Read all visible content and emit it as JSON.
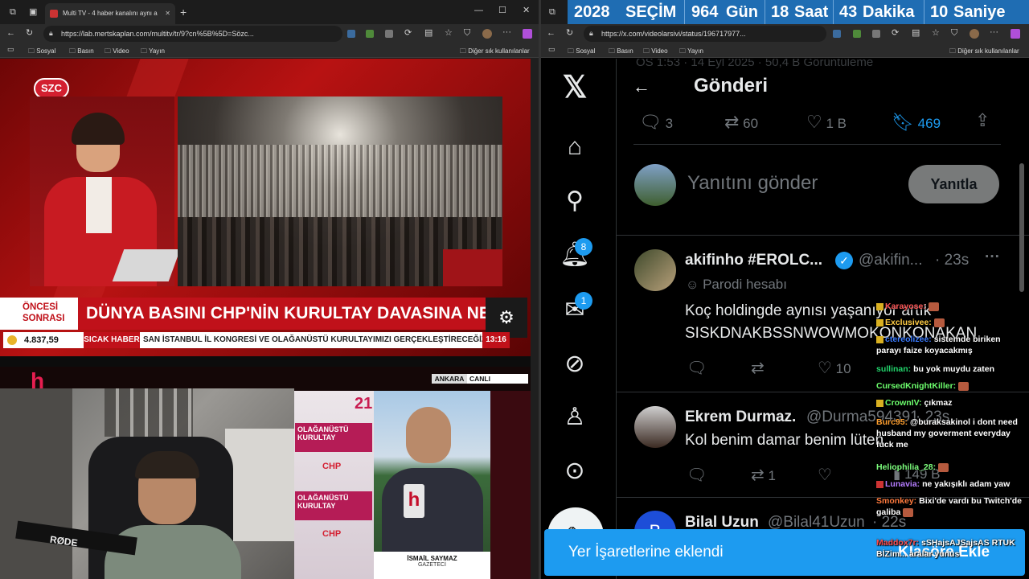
{
  "left_browser": {
    "tab_title": "Multi TV - 4 haber kanalını aynı a",
    "url": "https://lab.mertskaplan.com/multitv/tr/9?cn%5B%5D=Sözc...",
    "bookmarks": [
      "Sosyal",
      "Basın",
      "Video",
      "Yayın"
    ],
    "other_bookmarks": "Diğer sık kullanılanlar"
  },
  "tv1": {
    "channel_logo": "SZC",
    "side_label": "ÖNCESİ SONRASI",
    "headline": "DÜNYA BASINI CHP'NİN KURULTAY DAVASINA NE DİYO",
    "ticker_value": "4.837,59",
    "breaking_label": "SICAK HABER",
    "ticker_text": "SAN İSTANBUL İL KONGRESİ VE OLAĞANÜSTÜ KURULTAYIMIZI GERÇEKLEŞTİRECEĞİZ",
    "time": "13:16"
  },
  "tv2": {
    "location_label": "ANKARA",
    "live_label": "CANLI",
    "reporter_name": "İSMAİL SAYMAZ",
    "reporter_title": "GAZETECİ",
    "banner_texts": [
      "OLAĞANÜSTÜ KURULTAY",
      "21",
      "CHP"
    ]
  },
  "webcam": {
    "mic_brand": "RØDE"
  },
  "countdown": {
    "year": "2028",
    "label": "SEÇİM",
    "days": "964",
    "days_label": "Gün",
    "hours": "18",
    "hours_label": "Saat",
    "minutes": "43",
    "minutes_label": "Dakika",
    "seconds": "10",
    "seconds_label": "Saniye"
  },
  "right_browser": {
    "url": "https://x.com/videolarsivi/status/196717977...",
    "bookmarks": [
      "Sosyal",
      "Basın",
      "Video",
      "Yayın"
    ],
    "other_bookmarks": "Diğer sık kullanılanlar"
  },
  "x": {
    "page_title": "Gönderi",
    "faded_header": "ÖS 1:53 · 14 Eyl 2025 · 50,4 B Görüntüleme",
    "stats": {
      "replies": "3",
      "reposts": "60",
      "likes": "1 B",
      "bookmarks": "469"
    },
    "reply_placeholder": "Yanıtını gönder",
    "reply_button": "Yanıtla",
    "notif_badge": "8",
    "msg_badge": "1",
    "tweets": [
      {
        "name": "akifinho #EROLC...",
        "handle": "@akifin...",
        "time": "· 23s",
        "label": "Parodi hesabı",
        "line1": "Koç holdingde aynısı yaşanıyor artık",
        "line2": "SISKDNAKBSSNWOWMOKONKONAKAN",
        "likes": "10"
      },
      {
        "name": "Ekrem Durmaz.",
        "handle": "@Durma594391",
        "time": "· 23s",
        "line1": "Kol benim damar benim lüten",
        "reposts": "1",
        "views": "149 B"
      },
      {
        "name": "Bilal Uzun",
        "handle": "@Bilal41Uzun",
        "time": "· 22s"
      }
    ],
    "toast": "Yer İşaretlerine eklendi",
    "toast_action": "Klasöre Ekle"
  },
  "chat": [
    {
      "user": "Karayose:",
      "msg": "",
      "color": "#ff5757"
    },
    {
      "user": "Exclusivee:",
      "msg": "",
      "color": "#ffcc44"
    },
    {
      "user": "ctereolizee:",
      "msg": "sistemde biriken parayı faize koyacakmış",
      "color": "#3a7bff"
    },
    {
      "user": "sullinan:",
      "msg": "bu yok muydu zaten",
      "color": "#22d36b"
    },
    {
      "user": "CursedKnightKiller:",
      "msg": "",
      "color": "#6dff6d"
    },
    {
      "user": "CrownIV:",
      "msg": "çıkmaz",
      "color": "#6dff6d"
    },
    {
      "user": "Burc95:",
      "msg": "@buraksakinol i dont need husband my goverment everyday fuck me",
      "color": "#ff9f2e"
    },
    {
      "user": "Heliophilia_28:",
      "msg": "",
      "color": "#7dff7d"
    },
    {
      "user": "Lunavia:",
      "msg": "ne yakışıklı adam yaw",
      "color": "#b57cff"
    },
    {
      "user": "Smonkey:",
      "msg": "Bixi'de vardı bu Twitch'de galiba",
      "color": "#ff7a3d"
    },
    {
      "user": "Maddox7r:",
      "msg": "sSHajsAJSajsAS RTUK BİZim... aralar yunus",
      "color": "#ff4d4d"
    }
  ]
}
